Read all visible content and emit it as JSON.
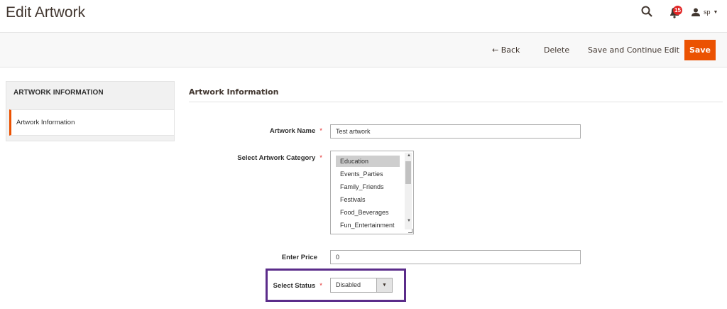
{
  "header": {
    "title": "Edit Artwork",
    "notification_count": "15",
    "user_name": "sp",
    "icons": {
      "search": "search-icon",
      "bell": "bell-icon",
      "user": "user-icon"
    }
  },
  "action_bar": {
    "back_label": "← Back",
    "delete_label": "Delete",
    "save_continue_label": "Save and Continue Edit",
    "save_label": "Save",
    "accent_color": "#eb5202"
  },
  "sidebar": {
    "title": "ARTWORK INFORMATION",
    "items": [
      {
        "label": "Artwork Information"
      }
    ]
  },
  "form": {
    "section_title": "Artwork Information",
    "artwork_name": {
      "label": "Artwork Name",
      "value": "Test artwork",
      "required": "*"
    },
    "category": {
      "label": "Select Artwork Category",
      "required": "*",
      "options": [
        "Education",
        "Events_Parties",
        "Family_Friends",
        "Festivals",
        "Food_Beverages",
        "Fun_Entertainment"
      ],
      "selected": "Education"
    },
    "price": {
      "label": "Enter Price",
      "value": "0"
    },
    "status": {
      "label": "Select Status",
      "value": "Disabled",
      "required": "*"
    }
  }
}
